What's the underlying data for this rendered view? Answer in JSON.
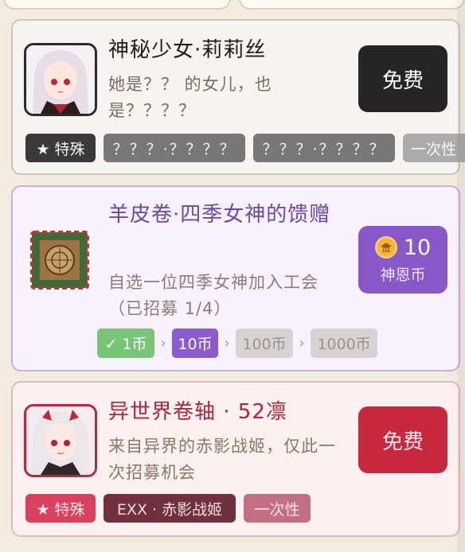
{
  "cards": [
    {
      "title": "神秘少女·莉莉丝",
      "desc": "她是？？ 的女儿，也是？？？？",
      "button": "免费",
      "tags": [
        "★ 特殊",
        "？？？·？？？？",
        "？？？·？？？？",
        "一次性"
      ]
    },
    {
      "title": "羊皮卷·四季女神的馈赠",
      "desc": "自选一位四季女神加入工会（已招募 1/4）",
      "cost": {
        "amount": "10",
        "currency": "神恩币"
      },
      "steps": [
        "✓ 1币",
        "10币",
        "100币",
        "1000币"
      ],
      "step_sep": "›"
    },
    {
      "title": "异世界卷轴 · 52凛",
      "desc": "来自异界的赤影战姬，仅此一次招募机会",
      "button": "免费",
      "tags": [
        "★ 特殊",
        "EXX · 赤影战姬",
        "一次性"
      ]
    }
  ],
  "colors": {
    "page_bg": "#f3ebe0",
    "special_red": "#c8283e",
    "currency_purple": "#8858c8",
    "dark_button": "#262626"
  },
  "icons": [
    "lilith-avatar",
    "parchment-scroll-icon",
    "coin-icon",
    "red-warrior-avatar"
  ]
}
